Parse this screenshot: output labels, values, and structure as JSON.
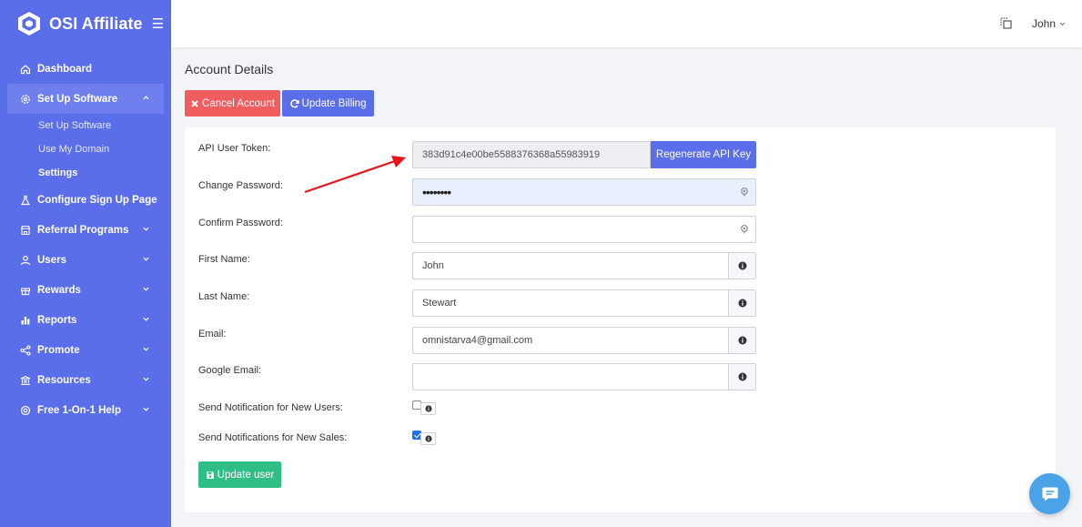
{
  "app": {
    "name": "OSI Affiliate"
  },
  "sidebar": {
    "items": [
      {
        "label": "Dashboard",
        "icon": "home-icon"
      },
      {
        "label": "Set Up Software",
        "icon": "gear-icon",
        "expanded": true,
        "sub": [
          "Set Up Software",
          "Use My Domain",
          "Settings"
        ],
        "current": "Settings"
      },
      {
        "label": "Configure Sign Up Page",
        "icon": "flask-icon"
      },
      {
        "label": "Referral Programs",
        "icon": "store-icon"
      },
      {
        "label": "Users",
        "icon": "user-icon"
      },
      {
        "label": "Rewards",
        "icon": "gift-icon"
      },
      {
        "label": "Reports",
        "icon": "bar-chart-icon"
      },
      {
        "label": "Promote",
        "icon": "share-icon"
      },
      {
        "label": "Resources",
        "icon": "bank-icon"
      },
      {
        "label": "Free 1-On-1 Help",
        "icon": "lifebuoy-icon"
      }
    ]
  },
  "topbar": {
    "user": "John"
  },
  "page": {
    "title": "Account Details",
    "cancel_label": "Cancel Account",
    "billing_label": "Update Billing"
  },
  "form": {
    "api_token_label": "API User Token:",
    "api_token_value": "383d91c4e00be5588376368a55983919",
    "regen_label": "Regenerate API Key",
    "change_password_label": "Change Password:",
    "change_password_value": "••••••••",
    "confirm_password_label": "Confirm Password:",
    "first_name_label": "First Name:",
    "first_name_value": "John",
    "last_name_label": "Last Name:",
    "last_name_value": "Stewart",
    "email_label": "Email:",
    "email_value": "omnistarva4@gmail.com",
    "google_email_label": "Google Email:",
    "google_email_value": "",
    "notify_users_label": "Send Notification for New Users:",
    "notify_users_checked": false,
    "notify_sales_label": "Send Notifications for New Sales:",
    "notify_sales_checked": true,
    "update_label": "Update user"
  },
  "colors": {
    "sidebar": "#5b6ee9",
    "danger": "#f05d5e",
    "primary": "#5b6ee9",
    "success": "#2fbf86",
    "annotation_arrow": "#e8141c"
  }
}
